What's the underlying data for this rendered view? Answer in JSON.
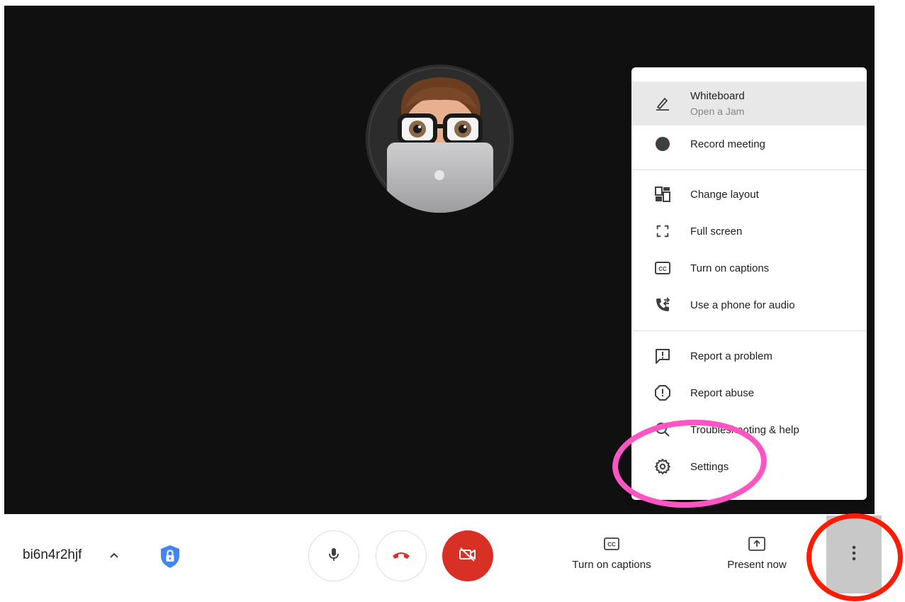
{
  "menu": {
    "items": [
      {
        "label": "Whiteboard",
        "sublabel": "Open a Jam",
        "icon": "pen-icon"
      },
      {
        "label": "Record meeting",
        "icon": "record-icon"
      },
      {
        "label": "Change layout",
        "icon": "layout-icon"
      },
      {
        "label": "Full screen",
        "icon": "fullscreen-icon"
      },
      {
        "label": "Turn on captions",
        "icon": "captions-icon"
      },
      {
        "label": "Use a phone for audio",
        "icon": "phone-audio-icon"
      },
      {
        "label": "Report a problem",
        "icon": "report-problem-icon"
      },
      {
        "label": "Report abuse",
        "icon": "report-abuse-icon"
      },
      {
        "label": "Troubleshooting & help",
        "icon": "troubleshooting-icon"
      },
      {
        "label": "Settings",
        "icon": "settings-gear-icon"
      }
    ]
  },
  "bottom_bar": {
    "meeting_code": "bi6n4r2hjf",
    "captions_label": "Turn on captions",
    "present_label": "Present now"
  },
  "colors": {
    "stage_bg": "#101010",
    "end_call_red": "#d93025",
    "camera_off_red": "#d93025",
    "shield_blue": "#4285f4",
    "highlight_ring_red": "#ff1a00",
    "highlight_ring_pink": "#ff55c3"
  }
}
